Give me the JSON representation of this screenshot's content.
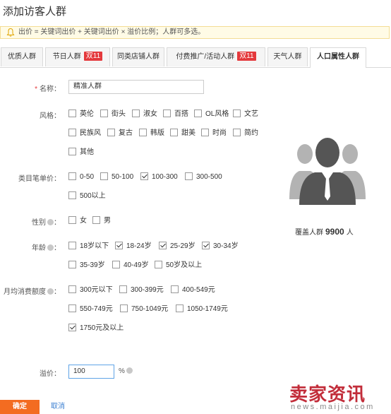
{
  "page_title": "添加访客人群",
  "notice": "出价 = 关键词出价 + 关键词出价 × 溢价比例；人群可多选。",
  "tabs": [
    {
      "label": "优质人群",
      "badge": ""
    },
    {
      "label": "节日人群",
      "badge": "双11"
    },
    {
      "label": "同类店铺人群",
      "badge": ""
    },
    {
      "label": "付费推广/活动人群",
      "badge": "双11"
    },
    {
      "label": "天气人群",
      "badge": ""
    },
    {
      "label": "人口属性人群",
      "badge": "",
      "active": true
    }
  ],
  "form": {
    "name": {
      "label": "名称：",
      "required_mark": "*",
      "value": "精准人群"
    },
    "style": {
      "label": "风格：",
      "options": [
        {
          "text": "英伦",
          "checked": false
        },
        {
          "text": "街头",
          "checked": false
        },
        {
          "text": "淑女",
          "checked": false
        },
        {
          "text": "百搭",
          "checked": false
        },
        {
          "text": "OL风格",
          "checked": false
        },
        {
          "text": "文艺",
          "checked": false
        },
        {
          "text": "民族风",
          "checked": false
        },
        {
          "text": "复古",
          "checked": false
        },
        {
          "text": "韩版",
          "checked": false
        },
        {
          "text": "甜美",
          "checked": false
        },
        {
          "text": "时尚",
          "checked": false
        },
        {
          "text": "简约",
          "checked": false
        },
        {
          "text": "其他",
          "checked": false
        }
      ]
    },
    "category_price": {
      "label": "类目笔单价：",
      "options": [
        {
          "text": "0-50",
          "checked": false
        },
        {
          "text": "50-100",
          "checked": false
        },
        {
          "text": "100-300",
          "checked": true
        },
        {
          "text": "300-500",
          "checked": false
        },
        {
          "text": "500以上",
          "checked": false
        }
      ]
    },
    "gender": {
      "label": "性别",
      "options": [
        {
          "text": "女",
          "checked": false
        },
        {
          "text": "男",
          "checked": false
        }
      ]
    },
    "age": {
      "label": "年龄",
      "options": [
        {
          "text": "18岁以下",
          "checked": false
        },
        {
          "text": "18-24岁",
          "checked": true
        },
        {
          "text": "25-29岁",
          "checked": true
        },
        {
          "text": "30-34岁",
          "checked": true
        },
        {
          "text": "35-39岁",
          "checked": false
        },
        {
          "text": "40-49岁",
          "checked": false
        },
        {
          "text": "50岁及以上",
          "checked": false
        }
      ]
    },
    "monthly_spend": {
      "label": "月均消费额度",
      "options": [
        {
          "text": "300元以下",
          "checked": false
        },
        {
          "text": "300-399元",
          "checked": false
        },
        {
          "text": "400-549元",
          "checked": false
        },
        {
          "text": "550-749元",
          "checked": false
        },
        {
          "text": "750-1049元",
          "checked": false
        },
        {
          "text": "1050-1749元",
          "checked": false
        },
        {
          "text": "1750元及以上",
          "checked": true
        }
      ]
    },
    "premium": {
      "label": "溢价：",
      "value": "100",
      "unit": "%"
    }
  },
  "coverage": {
    "prefix": "覆盖人群",
    "count": "9900",
    "suffix": "人"
  },
  "buttons": {
    "confirm": "确定",
    "cancel": "取消"
  },
  "watermark": {
    "cn": "卖家资讯",
    "en": "news.maijia.com"
  },
  "colors": {
    "accent": "#f36c21",
    "badge": "#e4393c",
    "link": "#3b7fd1",
    "watermark": "#c22d3a"
  }
}
